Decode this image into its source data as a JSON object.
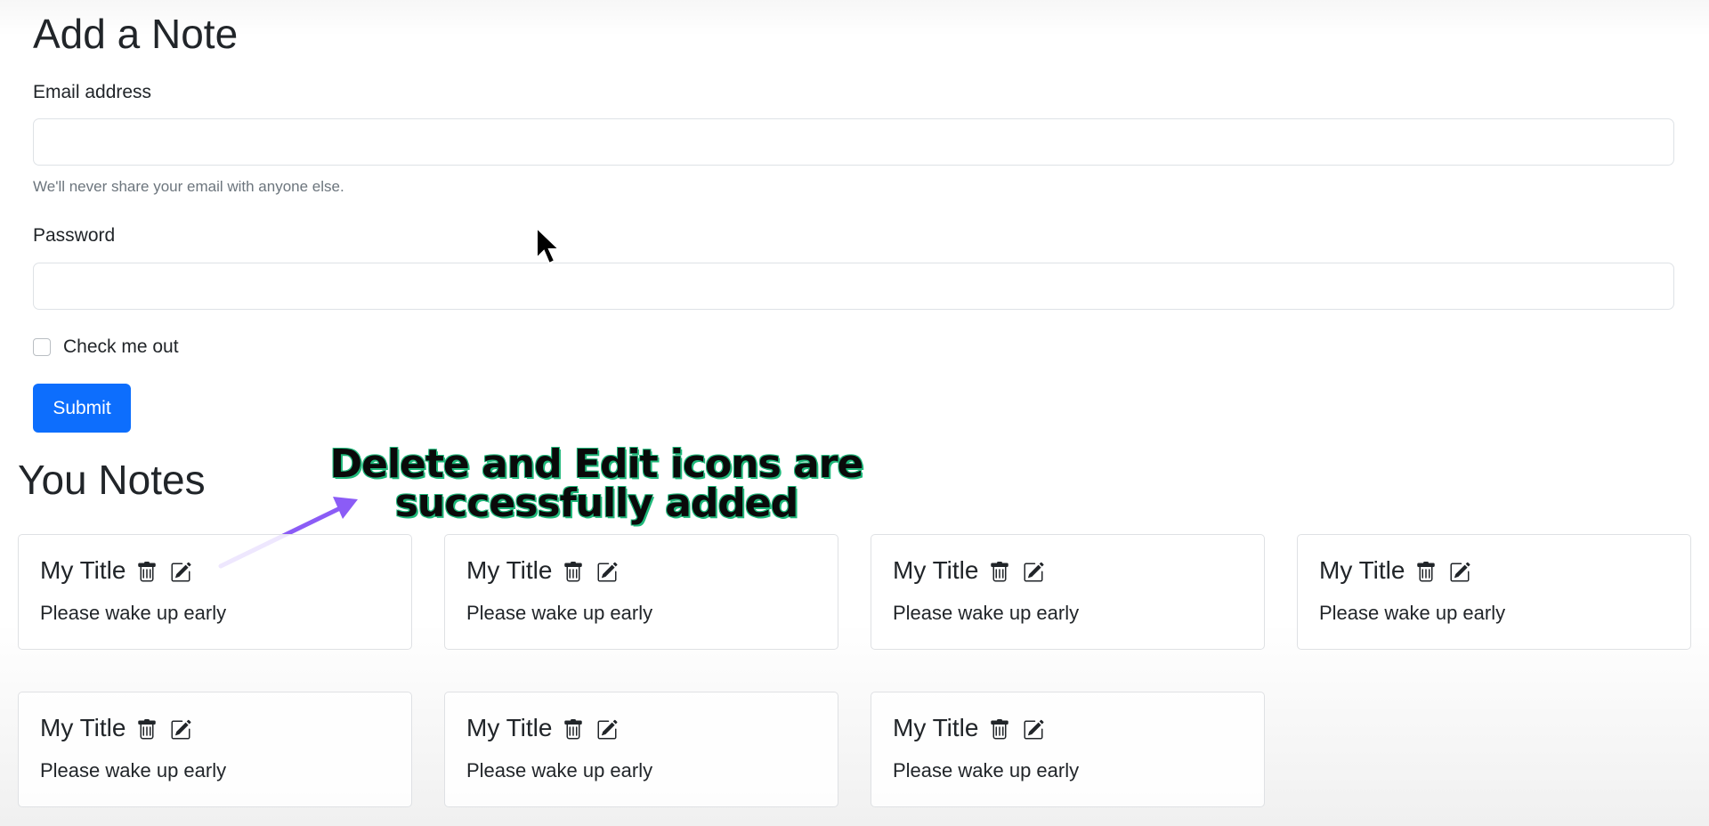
{
  "form": {
    "title": "Add a Note",
    "email_label": "Email address",
    "email_value": "",
    "email_help": "We'll never share your email with anyone else.",
    "password_label": "Password",
    "password_value": "",
    "checkbox_label": "Check me out",
    "checkbox_checked": false,
    "submit_label": "Submit"
  },
  "notes": {
    "heading": "You Notes",
    "items": [
      {
        "title": "My Title",
        "description": "Please wake up early"
      },
      {
        "title": "My Title",
        "description": "Please wake up early"
      },
      {
        "title": "My Title",
        "description": "Please wake up early"
      },
      {
        "title": "My Title",
        "description": "Please wake up early"
      },
      {
        "title": "My Title",
        "description": "Please wake up early"
      },
      {
        "title": "My Title",
        "description": "Please wake up early"
      },
      {
        "title": "My Title",
        "description": "Please wake up early"
      }
    ],
    "icons": [
      "trash-icon",
      "edit-icon"
    ]
  },
  "annotation": {
    "line1": "Delete and Edit icons are",
    "line2": "successfully added",
    "text_color": "#0a0a0a",
    "outline_color": "#1fb87a",
    "arrow_color": "#8b5cf6"
  },
  "colors": {
    "primary": "#0d6efd",
    "border": "#dee2e6",
    "muted": "#6c757d"
  }
}
